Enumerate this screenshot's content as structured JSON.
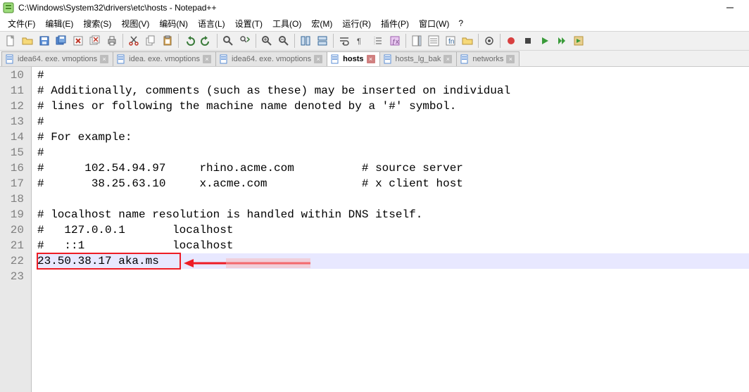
{
  "window": {
    "title": "C:\\Windows\\System32\\drivers\\etc\\hosts - Notepad++"
  },
  "menu": {
    "items": [
      "文件(F)",
      "编辑(E)",
      "搜索(S)",
      "视图(V)",
      "编码(N)",
      "语言(L)",
      "设置(T)",
      "工具(O)",
      "宏(M)",
      "运行(R)",
      "插件(P)",
      "窗口(W)"
    ],
    "help": "?"
  },
  "tabs": [
    {
      "label": "idea64. exe. vmoptions",
      "active": false
    },
    {
      "label": "idea. exe. vmoptions",
      "active": false
    },
    {
      "label": "idea64. exe. vmoptions",
      "active": false
    },
    {
      "label": "hosts",
      "active": true
    },
    {
      "label": "hosts_lg_bak",
      "active": false
    },
    {
      "label": "networks",
      "active": false
    }
  ],
  "editor": {
    "first_line_number": 10,
    "current_line_index": 12,
    "lines": [
      "#",
      "# Additionally, comments (such as these) may be inserted on individual",
      "# lines or following the machine name denoted by a '#' symbol.",
      "#",
      "# For example:",
      "#",
      "#      102.54.94.97     rhino.acme.com          # source server",
      "#       38.25.63.10     x.acme.com              # x client host",
      "",
      "# localhost name resolution is handled within DNS itself.",
      "#   127.0.0.1       localhost",
      "#   ::1             localhost",
      "23.50.38.17 aka.ms",
      ""
    ]
  }
}
